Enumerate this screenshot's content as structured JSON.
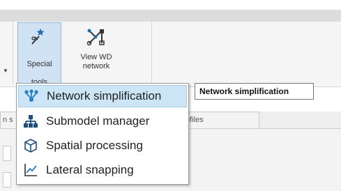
{
  "ribbon": {
    "special_tools": {
      "line1": "Special",
      "line2": "tools",
      "caret": "▾",
      "icon": "magic-wand-icon"
    },
    "view_wd": {
      "label": "View WD\nnetwork",
      "icon": "network-icon"
    }
  },
  "tabs": {
    "left_partial": "n s",
    "files_partial": "ofiles"
  },
  "menu": {
    "items": [
      {
        "label": "Network simplification",
        "icon": "network-simplification-icon"
      },
      {
        "label": "Submodel manager",
        "icon": "hierarchy-icon"
      },
      {
        "label": "Spatial processing",
        "icon": "cube-icon"
      },
      {
        "label": "Lateral snapping",
        "icon": "chart-line-icon"
      }
    ]
  },
  "tooltip": {
    "text": "Network simplification"
  },
  "colors": {
    "accent": "#1f6fb5",
    "hover": "#cde6f7",
    "selected_button": "#cfe3f4"
  }
}
